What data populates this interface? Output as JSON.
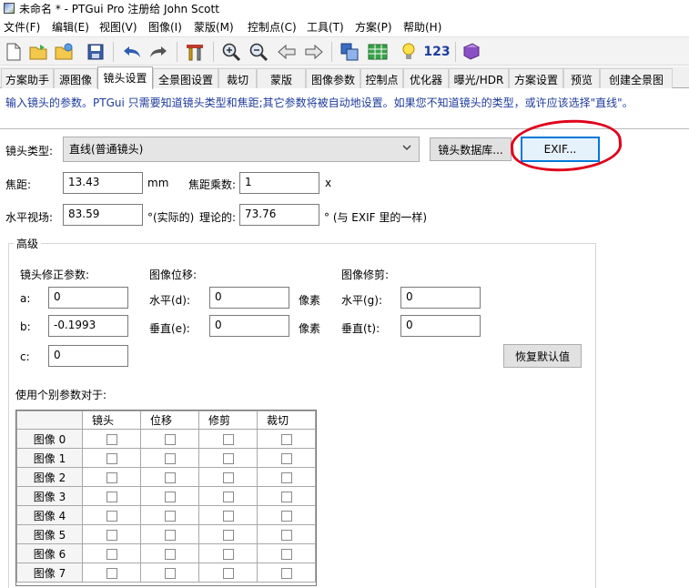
{
  "window": {
    "title": "未命名 * - PTGui Pro 注册给 John Scott"
  },
  "menu": [
    "文件(F)",
    "编辑(E)",
    "视图(V)",
    "图像(I)",
    "蒙版(M)",
    "控制点(C)",
    "工具(T)",
    "方案(P)",
    "帮助(H)"
  ],
  "toolbar": {
    "number_label": "123"
  },
  "tabs": [
    "方案助手",
    "源图像",
    "镜头设置",
    "全景图设置",
    "裁切",
    "蒙版",
    "图像参数",
    "控制点",
    "优化器",
    "曝光/HDR",
    "方案设置",
    "预览",
    "创建全景图"
  ],
  "active_tab": "镜头设置",
  "info_text": "输入镜头的参数。PTGui 只需要知道镜头类型和焦距;其它参数将被自动地设置。如果您不知道镜头的类型，或许应该选择\"直线\"。",
  "lens": {
    "type_label": "镜头类型:",
    "type_value": "直线(普通镜头)",
    "db_button": "镜头数据库...",
    "exif_button": "EXIF...",
    "focal_label": "焦距:",
    "focal_value": "13.43",
    "focal_unit": "mm",
    "multiplier_label": "焦距乘数:",
    "multiplier_value": "1",
    "multiplier_unit": "x",
    "hfov_label": "水平视场:",
    "hfov_value": "83.59",
    "hfov_unit": "°(实际的)",
    "theory_label": "理论的:",
    "theory_value": "73.76",
    "theory_note": "° (与 EXIF 里的一样)"
  },
  "advanced": {
    "legend": "高级",
    "correction_title": "镜头修正参数:",
    "a_label": "a:",
    "a_value": "0",
    "b_label": "b:",
    "b_value": "-0.1993",
    "c_label": "c:",
    "c_value": "0",
    "shift_title": "图像位移:",
    "shift_h_label": "水平(d):",
    "shift_h_value": "0",
    "shift_v_label": "垂直(e):",
    "shift_v_value": "0",
    "pixel_unit": "像素",
    "shear_title": "图像修剪:",
    "shear_h_label": "水平(g):",
    "shear_h_value": "0",
    "shear_v_label": "垂直(t):",
    "shear_v_value": "0",
    "reset_button": "恢复默认值",
    "individual_label": "使用个别参数对于:",
    "columns": [
      "镜头",
      "位移",
      "修剪",
      "裁切"
    ],
    "rows": [
      "图像 0",
      "图像 1",
      "图像 2",
      "图像 3",
      "图像 4",
      "图像 5",
      "图像 6",
      "图像 7"
    ]
  }
}
